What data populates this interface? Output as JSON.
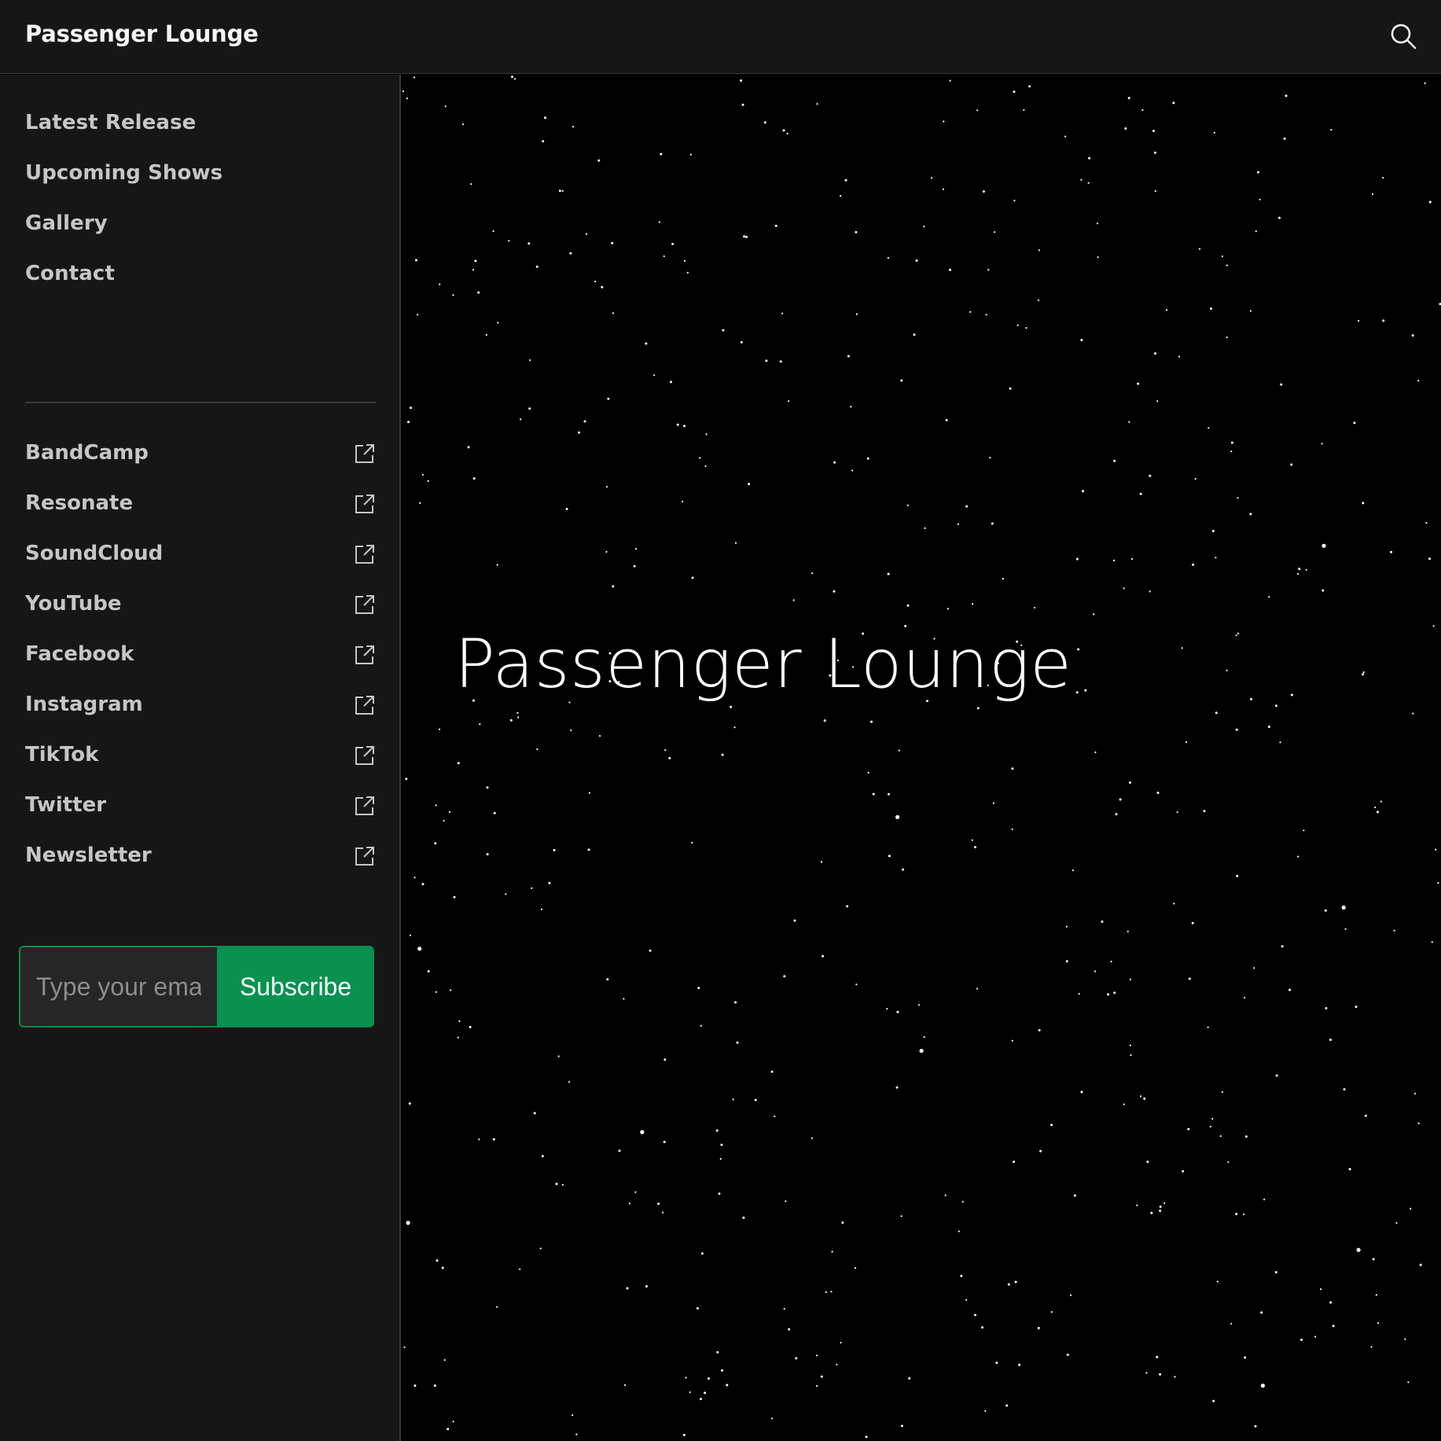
{
  "header": {
    "brand": "Passenger Lounge",
    "search_icon": "search-icon"
  },
  "sidebar": {
    "nav": [
      {
        "label": "Latest Release"
      },
      {
        "label": "Upcoming Shows"
      },
      {
        "label": "Gallery"
      },
      {
        "label": "Contact"
      }
    ],
    "external_links": [
      {
        "label": "BandCamp",
        "icon": "external-link-icon"
      },
      {
        "label": "Resonate",
        "icon": "external-link-icon"
      },
      {
        "label": "SoundCloud",
        "icon": "external-link-icon"
      },
      {
        "label": "YouTube",
        "icon": "external-link-icon"
      },
      {
        "label": "Facebook",
        "icon": "external-link-icon"
      },
      {
        "label": "Instagram",
        "icon": "external-link-icon"
      },
      {
        "label": "TikTok",
        "icon": "external-link-icon"
      },
      {
        "label": "Twitter",
        "icon": "external-link-icon"
      },
      {
        "label": "Newsletter",
        "icon": "external-link-icon"
      }
    ],
    "subscribe": {
      "placeholder": "Type your email",
      "button_label": "Subscribe"
    }
  },
  "hero": {
    "title": "Passenger Lounge"
  },
  "colors": {
    "background": "#000000",
    "panel": "#161616",
    "accent": "#0a9150",
    "text": "#c6c6c6"
  }
}
